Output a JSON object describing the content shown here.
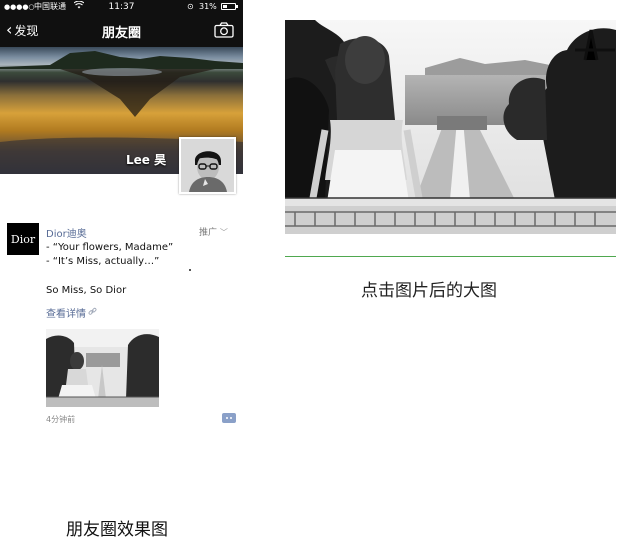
{
  "status_bar": {
    "carrier": "中国联通",
    "time": "11:37",
    "battery": "31%"
  },
  "nav": {
    "back_label": "发现",
    "title": "朋友圈"
  },
  "profile": {
    "name": "Lee 昊"
  },
  "post": {
    "logo_text": "Dior",
    "author": "Dior迪奥",
    "promo_label": "推广",
    "line1": "- “Your flowers, Madame”",
    "line2": "- “It’s Miss, actually…”",
    "slogan": "So Miss, So Dior",
    "detail_link": "查看详情",
    "time_ago": "4分钟前"
  },
  "captions": {
    "left": "朋友圈效果图",
    "right": "点击图片后的大图"
  },
  "colors": {
    "link_blue": "#576b95",
    "divider_green": "#4fa84f",
    "bar_black": "#101010"
  }
}
